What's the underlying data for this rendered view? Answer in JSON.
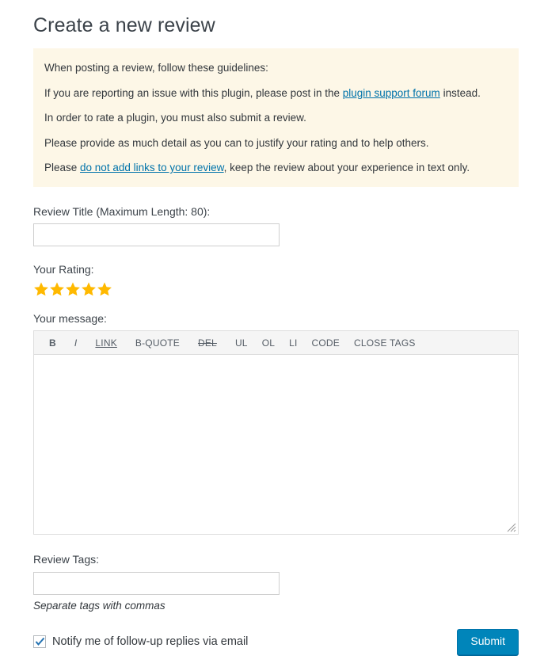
{
  "page_title": "Create a new review",
  "guidelines": {
    "lines": [
      {
        "prefix": "When posting a review, follow these guidelines:",
        "link": "",
        "suffix": ""
      },
      {
        "prefix": "If you are reporting an issue with this plugin, please post in the ",
        "link": "plugin support forum",
        "suffix": " instead."
      },
      {
        "prefix": "In order to rate a plugin, you must also submit a review.",
        "link": "",
        "suffix": ""
      },
      {
        "prefix": "Please provide as much detail as you can to justify your rating and to help others.",
        "link": "",
        "suffix": ""
      },
      {
        "prefix": "Please ",
        "link": "do not add links to your review",
        "suffix": ", keep the review about your experience in text only."
      }
    ]
  },
  "review_title": {
    "label": "Review Title (Maximum Length: 80):",
    "value": "",
    "placeholder": ""
  },
  "rating": {
    "label": "Your Rating:",
    "value": 5,
    "max": 5,
    "star_color": "#ffb900"
  },
  "message": {
    "label": "Your message:",
    "value": "",
    "placeholder": "",
    "toolbar": [
      {
        "name": "bold",
        "label": "B"
      },
      {
        "name": "italic",
        "label": "I"
      },
      {
        "name": "link",
        "label": "LINK"
      },
      {
        "name": "b-quote",
        "label": "B-QUOTE"
      },
      {
        "name": "del",
        "label": "DEL"
      },
      {
        "name": "ul",
        "label": "UL"
      },
      {
        "name": "ol",
        "label": "OL"
      },
      {
        "name": "li",
        "label": "LI"
      },
      {
        "name": "code",
        "label": "CODE"
      },
      {
        "name": "close-tags",
        "label": "CLOSE TAGS"
      }
    ]
  },
  "tags": {
    "label": "Review Tags:",
    "value": "",
    "placeholder": "",
    "help": "Separate tags with commas"
  },
  "notify": {
    "label": "Notify me of follow-up replies via email",
    "checked": true
  },
  "submit": {
    "label": "Submit",
    "color": "#0085ba"
  },
  "colors": {
    "notice_bg": "#fdf7e7",
    "link": "#0073aa",
    "text": "#32373c",
    "star": "#ffb900",
    "toolbar_bg": "#f5f5f5",
    "border": "#dedede"
  }
}
